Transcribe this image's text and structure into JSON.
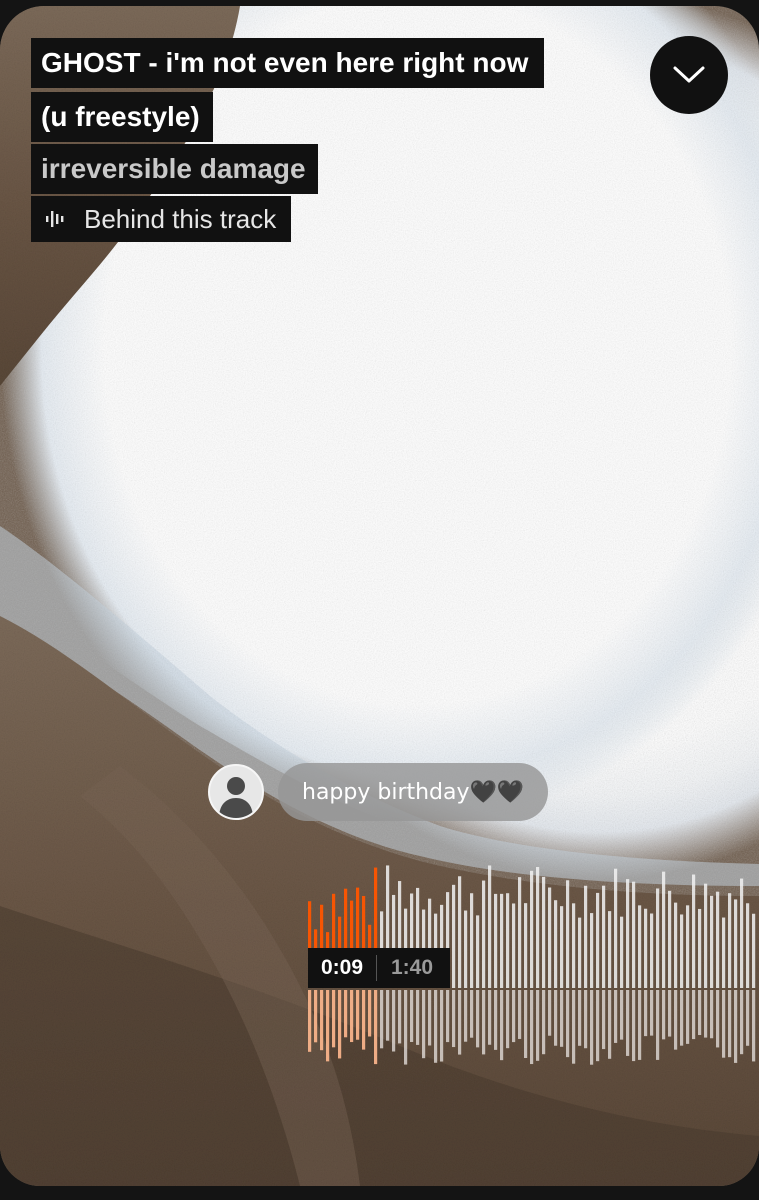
{
  "track": {
    "title_line1": "GHOST - i'm not even here right now",
    "title_line2": "(u freestyle)",
    "artist": "irreversible damage",
    "behind_label": "Behind this track"
  },
  "icons": {
    "collapse": "chevron-down-icon",
    "behind": "waveform-icon",
    "avatar": "user-silhouette-icon"
  },
  "comment": {
    "text": "happy birthday🖤🖤"
  },
  "player": {
    "current_time": "0:09",
    "total_time": "1:40",
    "progress": 0.09
  },
  "colors": {
    "accent": "#ff5500",
    "played_reflection": "#f7b28a",
    "label_background": "#111111"
  }
}
